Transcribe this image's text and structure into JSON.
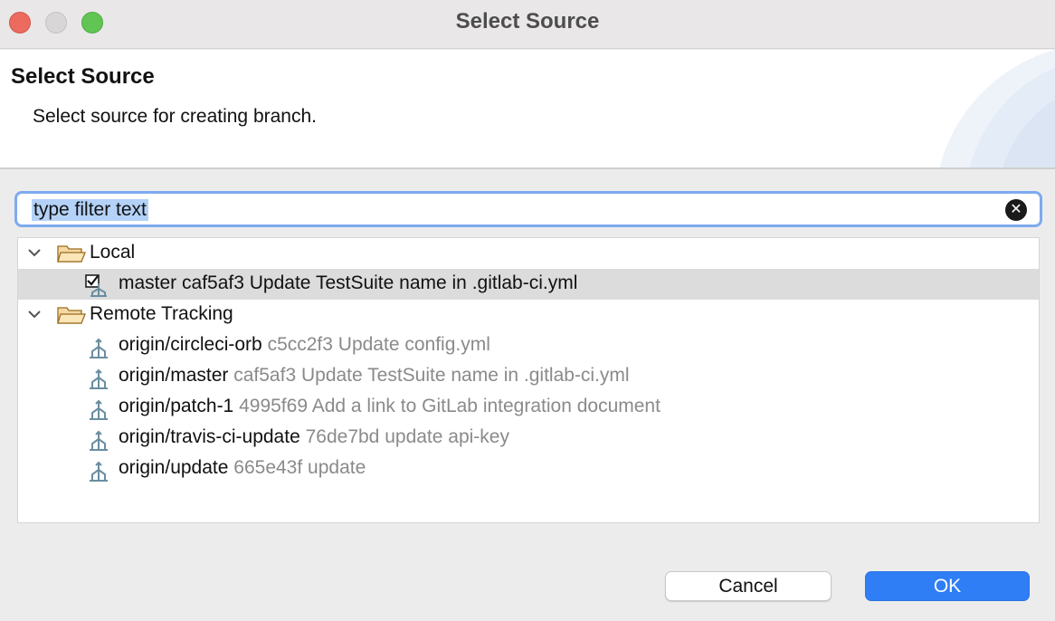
{
  "window": {
    "title": "Select Source"
  },
  "banner": {
    "title": "Select Source",
    "description": "Select source for creating branch."
  },
  "filter": {
    "value": "type filter text"
  },
  "tree": {
    "groups": [
      {
        "label": "Local",
        "items": [
          {
            "name": "master",
            "commit": "caf5af3",
            "message": "Update TestSuite name in .gitlab-ci.yml",
            "checked": true,
            "selected": true
          }
        ]
      },
      {
        "label": "Remote Tracking",
        "items": [
          {
            "name": "origin/circleci-orb",
            "commit": "c5cc2f3",
            "message": "Update config.yml"
          },
          {
            "name": "origin/master",
            "commit": "caf5af3",
            "message": "Update TestSuite name in .gitlab-ci.yml"
          },
          {
            "name": "origin/patch-1",
            "commit": "4995f69",
            "message": "Add a link to GitLab integration document"
          },
          {
            "name": "origin/travis-ci-update",
            "commit": "76de7bd",
            "message": "update api-key"
          },
          {
            "name": "origin/update",
            "commit": "665e43f",
            "message": "update"
          }
        ]
      }
    ]
  },
  "buttons": {
    "cancel": "Cancel",
    "ok": "OK"
  },
  "colors": {
    "accent": "#2f7ef6",
    "selection": "#dcdcdc",
    "filter_highlight": "#b4d2f8"
  }
}
